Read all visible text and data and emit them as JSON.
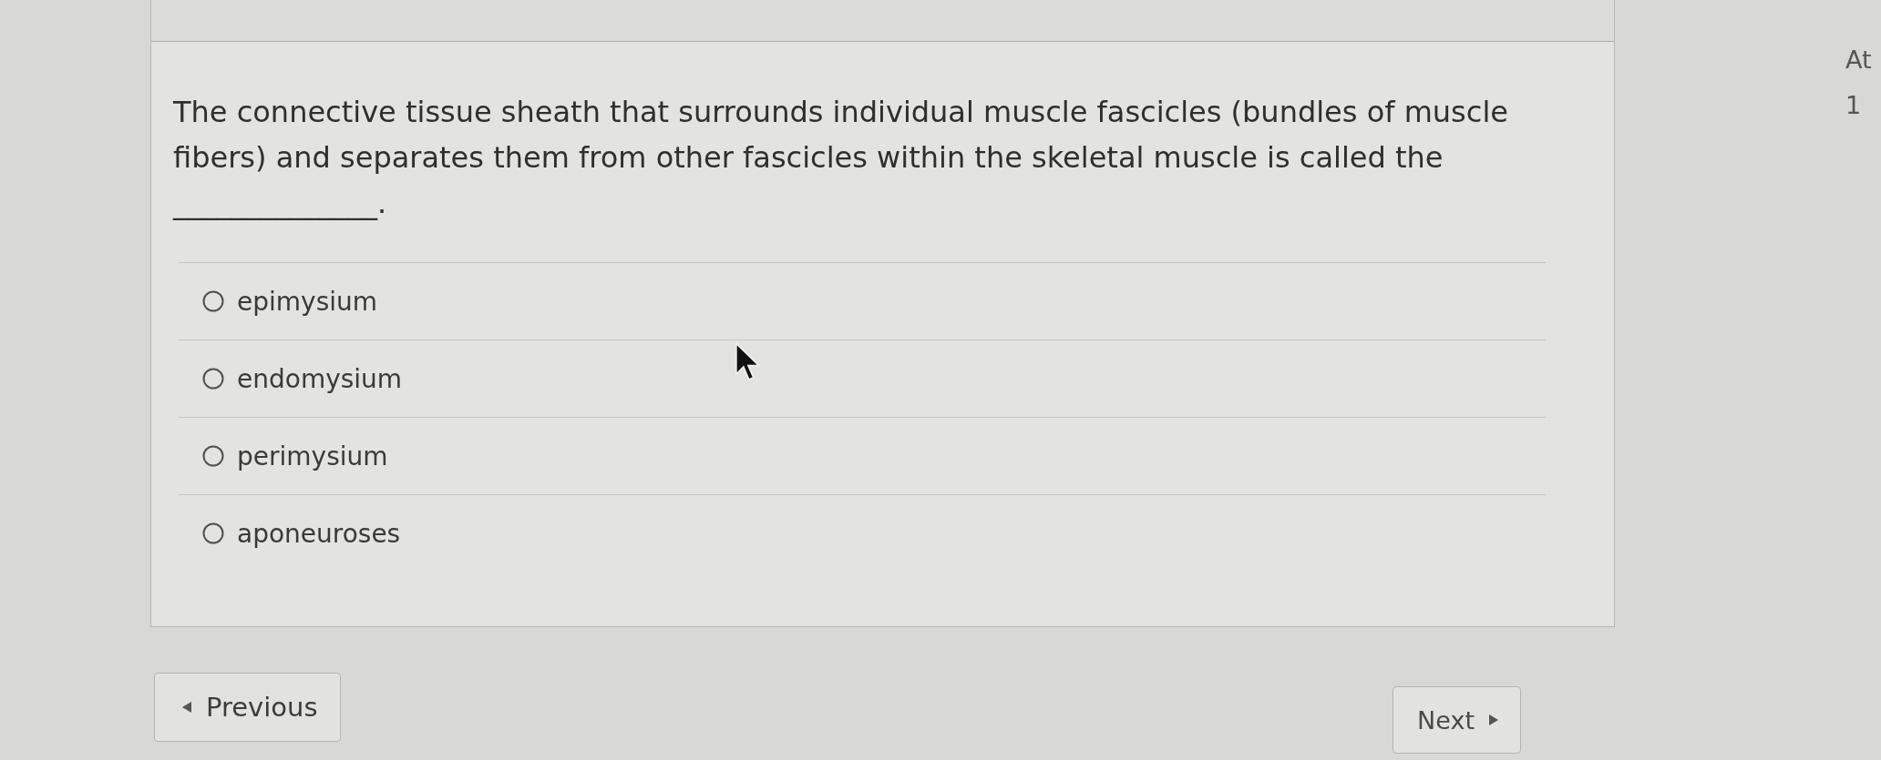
{
  "question": {
    "text": "The connective tissue sheath that surrounds individual muscle fascicles (bundles of muscle fibers) and separates them from other fascicles within the skeletal muscle is called the ______________."
  },
  "options": [
    {
      "label": "epimysium",
      "selected": false
    },
    {
      "label": "endomysium",
      "selected": false
    },
    {
      "label": "perimysium",
      "selected": false
    },
    {
      "label": "aponeuroses",
      "selected": false
    }
  ],
  "navigation": {
    "previous": {
      "label": "Previous"
    },
    "next": {
      "label": "Next"
    }
  },
  "sidebar": {
    "lines": [
      "At",
      "1"
    ]
  }
}
